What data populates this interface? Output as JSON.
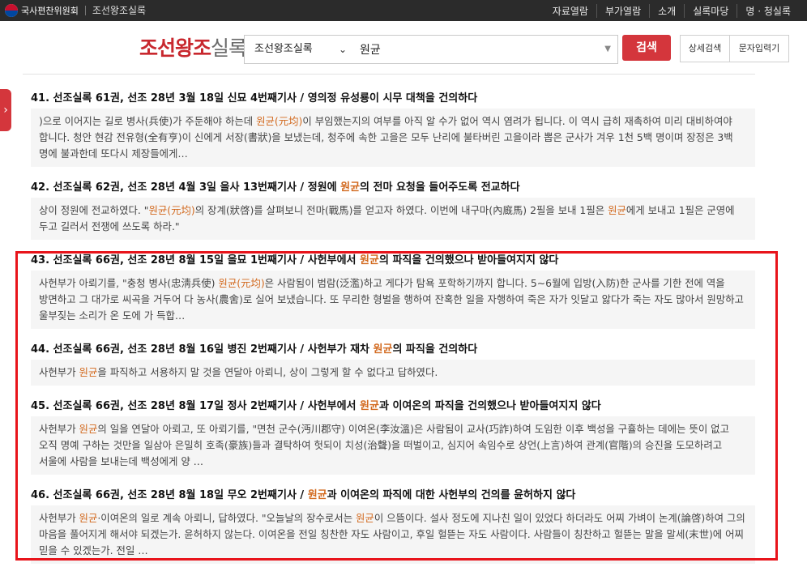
{
  "topbar": {
    "org": "국사편찬위원회",
    "site": "조선왕조실록",
    "nav": [
      "자료열람",
      "부가열람",
      "소개",
      "실록마당",
      "명 · 청실록"
    ]
  },
  "header": {
    "brand_red": "조선왕조",
    "brand_grey": "실록",
    "select_value": "조선왕조실록",
    "query": "원균",
    "search_label": "검색",
    "advanced_label": "상세검색",
    "charinput_label": "문자입력기"
  },
  "results": [
    {
      "title": [
        {
          "t": "41. 선조실록 61권, 선조 28년 3월 18일 신묘 4번째기사 / 영의정 유성룡이 시무 대책을 건의하다"
        }
      ],
      "snippet": [
        {
          "t": ")으로 이어지는 길로 병사(兵使)가 주둔해야 하는데 "
        },
        {
          "t": "원균(元均)",
          "h": true
        },
        {
          "t": "이 부임했는지의 여부를 아직 알 수가 없어 역시 염려가 됩니다. 이 역시 급히 재촉하여 미리 대비하여야 합니다. 청안 현감 전유형(全有亨)이 신에게 서장(書狀)을 보냈는데, 청주에 속한 고을은 모두 난리에 불타버린 고을이라 뽑은 군사가 겨우 1천 5백 명이며 장정은 3백 명에 불과한데 또다시 제장들에게…"
        }
      ]
    },
    {
      "title": [
        {
          "t": "42. 선조실록 62권, 선조 28년 4월 3일 을사 13번째기사 / 정원에 "
        },
        {
          "t": "원균",
          "h": true
        },
        {
          "t": "의 전마 요청을 들어주도록 전교하다"
        }
      ],
      "snippet": [
        {
          "t": "상이 정원에 전교하였다. \""
        },
        {
          "t": "원균(元均)",
          "h": true
        },
        {
          "t": "의 장계(狀啓)를 살펴보니 전마(戰馬)를 얻고자 하였다. 이번에 내구마(內廐馬) 2필을 보내 1필은 "
        },
        {
          "t": "원균",
          "h": true
        },
        {
          "t": "에게 보내고 1필은 군영에 두고 길러서 전쟁에 쓰도록 하라.\""
        }
      ]
    },
    {
      "title": [
        {
          "t": "43. 선조실록 66권, 선조 28년 8월 15일 을묘 1번째기사 / 사헌부에서 "
        },
        {
          "t": "원균",
          "h": true
        },
        {
          "t": "의 파직을 건의했으나 받아들여지지 않다"
        }
      ],
      "snippet": [
        {
          "t": "사헌부가 아뢰기를, \"충청 병사(忠淸兵使) "
        },
        {
          "t": "원균(元均)",
          "h": true
        },
        {
          "t": "은 사람됨이 범람(泛濫)하고 게다가 탐욕 포학하기까지 합니다. 5∼6월에 입방(入防)한 군사를 기한 전에 역을 방면하고 그 대가로 씨곡을 거두어 다 농사(農舍)로 실어 보냈습니다. 또 무리한 형벌을 행하여 잔혹한 일을 자행하여 죽은 자가 잇달고 앓다가 죽는 자도 많아서 원망하고 울부짖는 소리가 온 도에 가 득합…"
        }
      ]
    },
    {
      "title": [
        {
          "t": "44. 선조실록 66권, 선조 28년 8월 16일 병진 2번째기사 / 사헌부가 재차 "
        },
        {
          "t": "원균",
          "h": true
        },
        {
          "t": "의 파직을 건의하다"
        }
      ],
      "snippet": [
        {
          "t": "사헌부가 "
        },
        {
          "t": "원균",
          "h": true
        },
        {
          "t": "을 파직하고 서용하지 말 것을 연달아 아뢰니, 상이 그렇게 할 수 없다고 답하였다."
        }
      ]
    },
    {
      "title": [
        {
          "t": "45. 선조실록 66권, 선조 28년 8월 17일 정사 2번째기사 / 사헌부에서 "
        },
        {
          "t": "원균",
          "h": true
        },
        {
          "t": "과 이여온의 파직을 건의했으나 받아들여지지 않다"
        }
      ],
      "snippet": [
        {
          "t": "사헌부가 "
        },
        {
          "t": "원균",
          "h": true
        },
        {
          "t": "의 일을 연달아 아뢰고, 또 아뢰기를, \"면천 군수(沔川郡守) 이여온(李汝溫)은 사람됨이 교사(巧詐)하여 도임한 이후 백성을 구휼하는 데에는 뜻이 없고 오직 명예 구하는 것만을 일삼아 은밀히 호족(豪族)들과 결탁하여 헛되이 치성(治聲)을 떠벌이고, 심지어 속임수로 상언(上言)하여 관계(官階)의 승진을 도모하려고 서울에 사람을 보내는데 백성에게 양 …"
        }
      ]
    },
    {
      "title": [
        {
          "t": "46. 선조실록 66권, 선조 28년 8월 18일 무오 2번째기사 / "
        },
        {
          "t": "원균",
          "h": true
        },
        {
          "t": "과 이여온의 파직에 대한 사헌부의 건의를 윤허하지 않다"
        }
      ],
      "snippet": [
        {
          "t": "사헌부가 "
        },
        {
          "t": "원균",
          "h": true
        },
        {
          "t": "·이여온의 일로 계속 아뢰니, 답하였다. \"오늘날의 장수로서는 "
        },
        {
          "t": "원균",
          "h": true
        },
        {
          "t": "이 으뜸이다. 설사 정도에 지나친 일이 있었다 하더라도 어찌 가벼이 논계(論啓)하여 그의 마음을 풀어지게 해서야 되겠는가. 윤허하지 않는다. 이여온을 전일 칭찬한 자도 사람이고, 후일 헐뜯는 자도 사람이다. 사람들이 칭찬하고 헐뜯는 말을 말세(末世)에 어찌 믿을 수 있겠는가. 전일 …"
        }
      ]
    }
  ],
  "colors": {
    "accent": "#d4363c",
    "highlight": "#d2691e",
    "annotation_box": "#e8141b"
  }
}
